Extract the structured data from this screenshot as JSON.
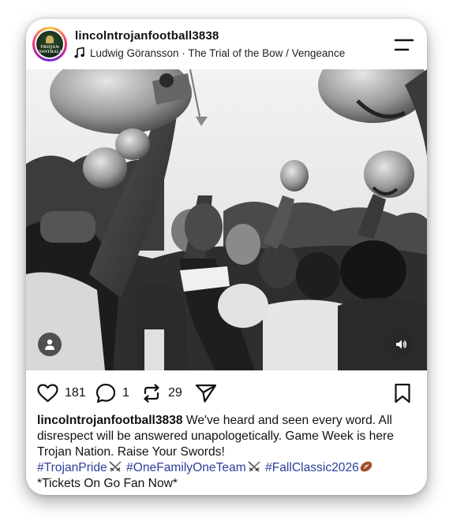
{
  "post": {
    "username": "lincolntrojanfootball3838",
    "avatar_text": "TROJAN FOOTBALL",
    "song": "Ludwig Göransson · The Trial of the Bow / Vengeance"
  },
  "actions": {
    "likes": "181",
    "comments": "1",
    "reposts": "29"
  },
  "caption": {
    "username": "lincolntrojanfootball3838",
    "text": " We've heard and seen every word. All disrespect will be answered unapologetically. Game Week is here Trojan Nation. Raise Your Swords!",
    "hashtag_1": "#TrojanPride",
    "hashtag_2": "#OneFamilyOneTeam",
    "hashtag_3": "#FallClassic2026",
    "footer": "*Tickets On Go Fan Now*"
  },
  "icons": {
    "music": "music-note-icon",
    "menu": "menu-icon",
    "tag": "person-tag-icon",
    "sound": "speaker-icon",
    "like": "heart-icon",
    "comment": "comment-bubble-icon",
    "repost": "repost-icon",
    "share": "send-icon",
    "save": "bookmark-icon",
    "emoji_1": "crossed-swords-emoji",
    "emoji_2": "american-football-emoji"
  },
  "colors": {
    "hashtag": "#2b3f9a",
    "story_ring": [
      "#f9ce34",
      "#ee2a7b",
      "#6228d7"
    ],
    "text": "#111111"
  }
}
